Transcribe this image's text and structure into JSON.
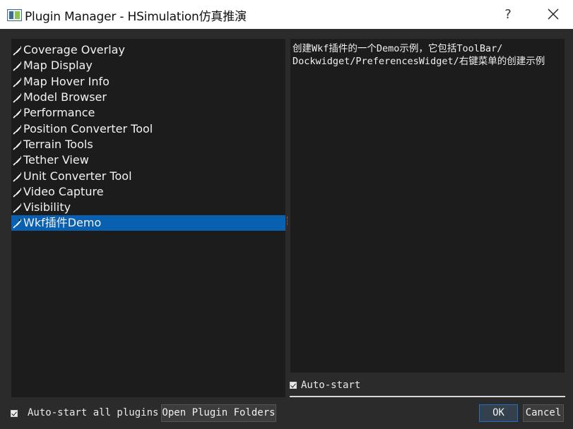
{
  "window": {
    "title": "Plugin Manager - HSimulation仿真推演",
    "help_label": "?"
  },
  "plugins": [
    {
      "label": "Coverage Overlay",
      "selected": false
    },
    {
      "label": "Map Display",
      "selected": false
    },
    {
      "label": "Map Hover Info",
      "selected": false
    },
    {
      "label": "Model Browser",
      "selected": false
    },
    {
      "label": "Performance",
      "selected": false
    },
    {
      "label": "Position Converter Tool",
      "selected": false
    },
    {
      "label": "Terrain Tools",
      "selected": false
    },
    {
      "label": "Tether View",
      "selected": false
    },
    {
      "label": "Unit Converter Tool",
      "selected": false
    },
    {
      "label": "Video Capture",
      "selected": false
    },
    {
      "label": "Visibility",
      "selected": false
    },
    {
      "label": "Wkf插件Demo",
      "selected": true
    }
  ],
  "description": {
    "lines": [
      "创建Wkf插件的一个Demo示例，它包括ToolBar/",
      "Dockwidget/PreferencesWidget/右键菜单的创建示例"
    ]
  },
  "plugin_autostart": {
    "label": "Auto-start",
    "checked": true
  },
  "footer": {
    "autostart_all_label": "Auto-start all plugins",
    "autostart_all_checked": true,
    "open_folders_label": "Open Plugin Folders",
    "ok_label": "OK",
    "cancel_label": "Cancel"
  },
  "colors": {
    "selection": "#0a60b0",
    "panel": "#1c1c1c",
    "background": "#2b2b2b"
  },
  "icons": {
    "plugin": "plug-icon",
    "close": "close-icon",
    "app": "app-icon"
  }
}
